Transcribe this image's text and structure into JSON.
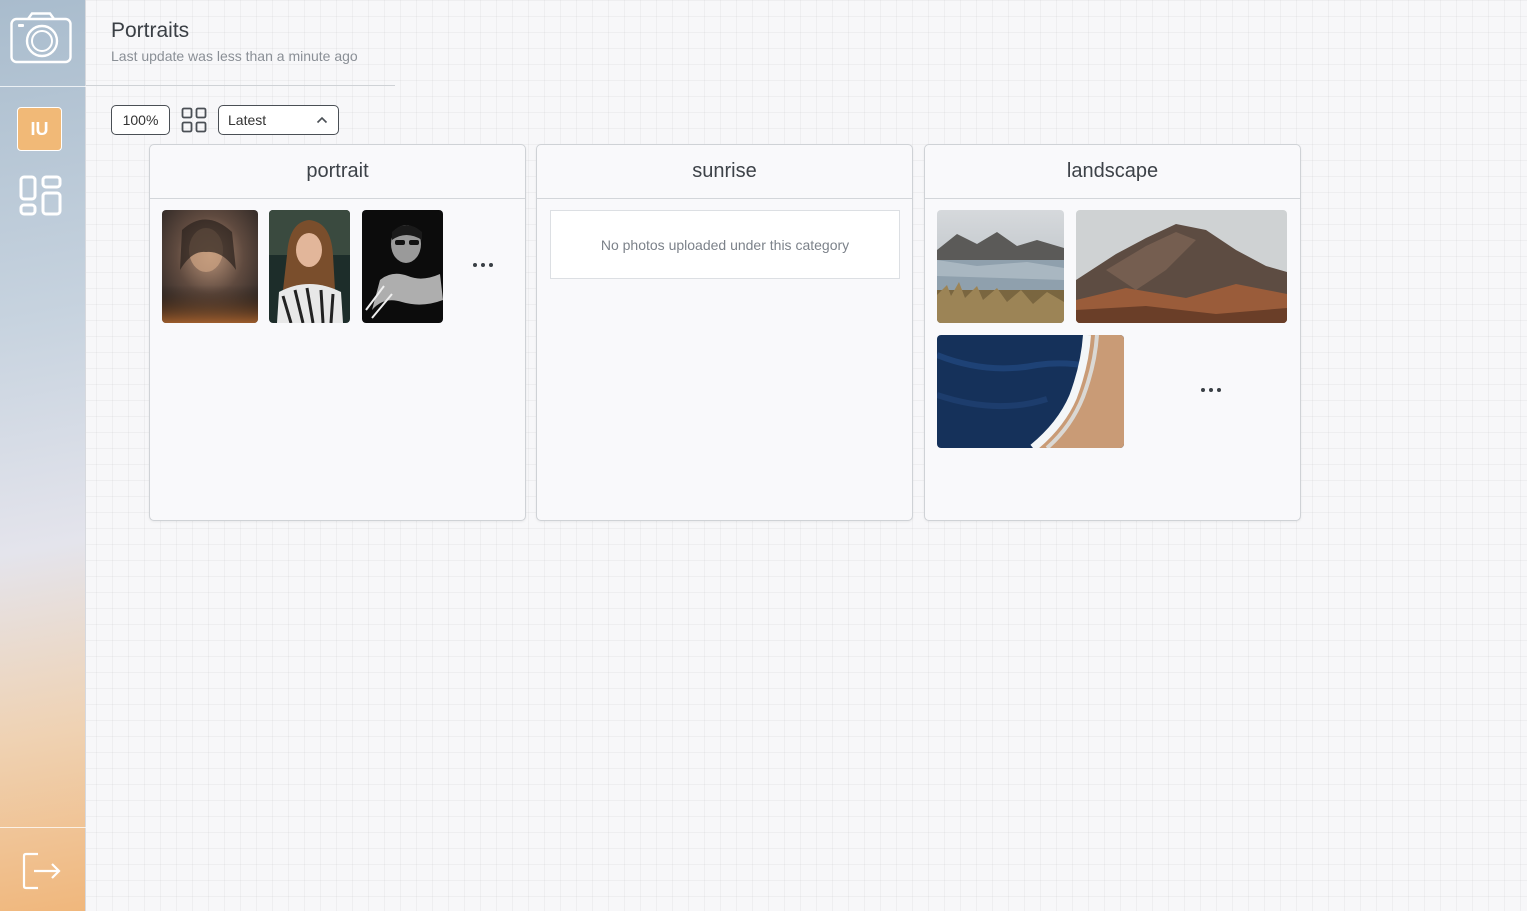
{
  "page": {
    "title": "Portraits",
    "subtitle": "Last update was less than a minute ago"
  },
  "sidebar": {
    "logo_icon": "camera-icon",
    "avatar_initials": "IU",
    "avatar_color": "#f1b977",
    "nav_icon": "dashboard-icon",
    "logout_icon": "logout-icon"
  },
  "toolbar": {
    "zoom_label": "100%",
    "view_icon": "grid-view-icon",
    "sort_selected": "Latest",
    "sort_icon": "chevron-up-icon"
  },
  "categories": [
    {
      "name": "portrait",
      "photos": [
        "portrait-photo-1",
        "portrait-photo-2",
        "portrait-photo-3"
      ],
      "has_more": true
    },
    {
      "name": "sunrise",
      "photos": [],
      "empty_message": "No photos uploaded under this category"
    },
    {
      "name": "landscape",
      "photos": [
        "landscape-photo-lake",
        "landscape-photo-mountain",
        "landscape-photo-ocean"
      ],
      "has_more": true
    }
  ]
}
